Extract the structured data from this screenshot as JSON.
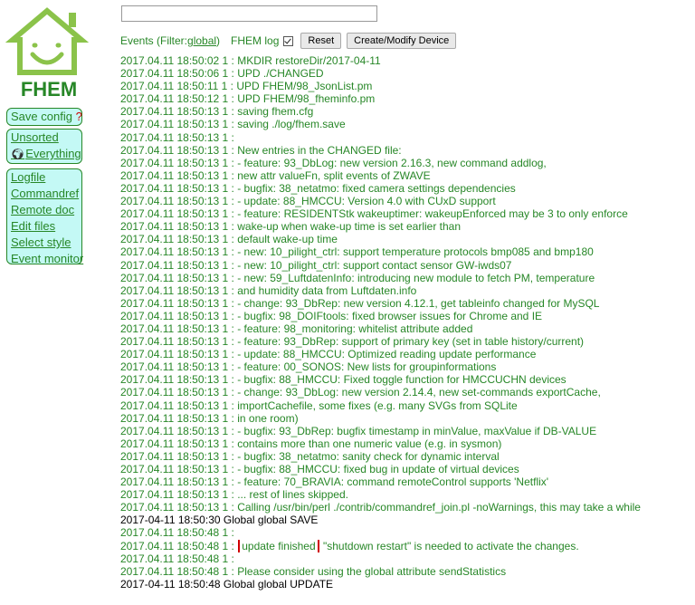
{
  "logo": {
    "text": "FHEM"
  },
  "menu": {
    "save_config": "Save config",
    "save_config_flag": "?",
    "rooms": [
      {
        "label": "Unsorted"
      },
      {
        "label": "Everything",
        "icon": "globe-icon"
      }
    ],
    "links": [
      {
        "label": "Logfile"
      },
      {
        "label": "Commandref"
      },
      {
        "label": "Remote doc"
      },
      {
        "label": "Edit files"
      },
      {
        "label": "Select style"
      },
      {
        "label": "Event monitor"
      }
    ]
  },
  "command_input": {
    "value": ""
  },
  "events": {
    "prefix": "Events (Filter: ",
    "filter": "global",
    "suffix": ")",
    "fhem_log_label": "FHEM log",
    "fhem_log_checked": true,
    "reset_label": "Reset",
    "create_label": "Create/Modify Device"
  },
  "log": [
    {
      "t": "2017.04.11 18:50:02 1 : MKDIR restoreDir/2017-04-11"
    },
    {
      "t": "2017.04.11 18:50:06 1 : UPD ./CHANGED"
    },
    {
      "t": "2017.04.11 18:50:11 1 : UPD FHEM/98_JsonList.pm"
    },
    {
      "t": "2017.04.11 18:50:12 1 : UPD FHEM/98_fheminfo.pm"
    },
    {
      "t": "2017.04.11 18:50:13 1 : saving fhem.cfg"
    },
    {
      "t": "2017.04.11 18:50:13 1 : saving ./log/fhem.save"
    },
    {
      "t": "2017.04.11 18:50:13 1 :"
    },
    {
      "t": "2017.04.11 18:50:13 1 : New entries in the CHANGED file:"
    },
    {
      "t": "2017.04.11 18:50:13 1 : - feature: 93_DbLog: new version 2.16.3, new command addlog,"
    },
    {
      "t": "2017.04.11 18:50:13 1 : new attr valueFn, split events of ZWAVE"
    },
    {
      "t": "2017.04.11 18:50:13 1 : - bugfix: 38_netatmo: fixed camera settings dependencies"
    },
    {
      "t": "2017.04.11 18:50:13 1 : - update: 88_HMCCU: Version 4.0 with CUxD support"
    },
    {
      "t": "2017.04.11 18:50:13 1 : - feature: RESIDENTStk wakeuptimer: wakeupEnforced may be 3 to only enforce"
    },
    {
      "t": "2017.04.11 18:50:13 1 : wake-up when wake-up time is set earlier than"
    },
    {
      "t": "2017.04.11 18:50:13 1 : default wake-up time"
    },
    {
      "t": "2017.04.11 18:50:13 1 : - new: 10_pilight_ctrl: support temperature protocols bmp085 and bmp180"
    },
    {
      "t": "2017.04.11 18:50:13 1 : - new: 10_pilight_ctrl: support contact sensor GW-iwds07"
    },
    {
      "t": "2017.04.11 18:50:13 1 : - new: 59_LuftdatenInfo: introducing new module to fetch PM, temperature"
    },
    {
      "t": "2017.04.11 18:50:13 1 : and humidity data from Luftdaten.info"
    },
    {
      "t": "2017.04.11 18:50:13 1 : - change: 93_DbRep: new version 4.12.1, get tableinfo changed for MySQL"
    },
    {
      "t": "2017.04.11 18:50:13 1 : - bugfix: 98_DOIFtools: fixed browser issues for Chrome and IE"
    },
    {
      "t": "2017.04.11 18:50:13 1 : - feature: 98_monitoring: whitelist attribute added"
    },
    {
      "t": "2017.04.11 18:50:13 1 : - feature: 93_DbRep: support of primary key (set in table history/current)"
    },
    {
      "t": "2017.04.11 18:50:13 1 : - update: 88_HMCCU: Optimized reading update performance"
    },
    {
      "t": "2017.04.11 18:50:13 1 : - feature: 00_SONOS: New lists for groupinformations"
    },
    {
      "t": "2017.04.11 18:50:13 1 : - bugfix: 88_HMCCU: Fixed toggle function for HMCCUCHN devices"
    },
    {
      "t": "2017.04.11 18:50:13 1 : - change: 93_DbLog: new version 2.14.4, new set-commands exportCache,"
    },
    {
      "t": "2017.04.11 18:50:13 1 : importCachefile, some fixes (e.g. many SVGs from SQLite"
    },
    {
      "t": "2017.04.11 18:50:13 1 : in one room)"
    },
    {
      "t": "2017.04.11 18:50:13 1 : - bugfix: 93_DbRep: bugfix timestamp in minValue, maxValue if DB-VALUE"
    },
    {
      "t": "2017.04.11 18:50:13 1 : contains more than one numeric value (e.g. in sysmon)"
    },
    {
      "t": "2017.04.11 18:50:13 1 : - bugfix: 38_netatmo: sanity check for dynamic interval"
    },
    {
      "t": "2017.04.11 18:50:13 1 : - bugfix: 88_HMCCU: fixed bug in update of virtual devices"
    },
    {
      "t": "2017.04.11 18:50:13 1 : - feature: 70_BRAVIA: command remoteControl supports 'Netflix'"
    },
    {
      "t": "2017.04.11 18:50:13 1 : ... rest of lines skipped."
    },
    {
      "t": "2017.04.11 18:50:13 1 : Calling /usr/bin/perl ./contrib/commandref_join.pl -noWarnings, this may take a while"
    },
    {
      "t": "2017-04-11 18:50:30 Global global SAVE",
      "event": true
    },
    {
      "t": "2017.04.11 18:50:48 1 :"
    },
    {
      "pre": "2017.04.11 18:50:48 1 : ",
      "hl": "update finished",
      "post": " \"shutdown restart\" is needed to activate the changes."
    },
    {
      "t": "2017.04.11 18:50:48 1 :"
    },
    {
      "t": "2017.04.11 18:50:48 1 : Please consider using the global attribute sendStatistics"
    },
    {
      "t": "2017-04-11 18:50:48 Global global UPDATE",
      "event": true
    }
  ]
}
